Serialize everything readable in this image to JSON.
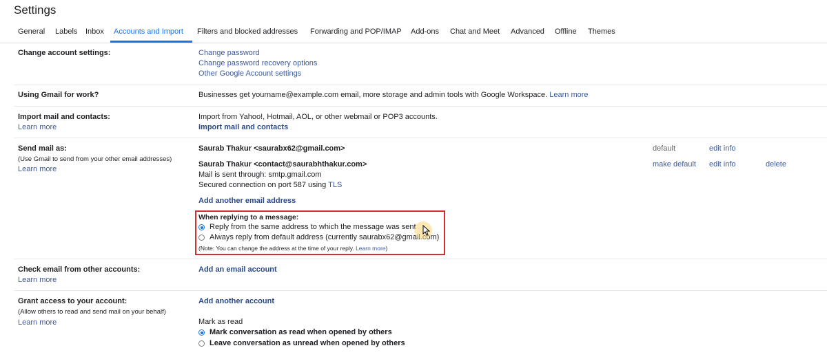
{
  "page_title": "Settings",
  "tabs": [
    {
      "label": "General"
    },
    {
      "label": "Labels"
    },
    {
      "label": "Inbox"
    },
    {
      "label": "Accounts and Import",
      "active": true
    },
    {
      "label": "Filters and blocked addresses"
    },
    {
      "label": "Forwarding and POP/IMAP"
    },
    {
      "label": "Add-ons"
    },
    {
      "label": "Chat and Meet"
    },
    {
      "label": "Advanced"
    },
    {
      "label": "Offline"
    },
    {
      "label": "Themes"
    }
  ],
  "change_account": {
    "label": "Change account settings:",
    "links": [
      "Change password",
      "Change password recovery options",
      "Other Google Account settings"
    ]
  },
  "gmail_work": {
    "label": "Using Gmail for work?",
    "text": "Businesses get yourname@example.com email, more storage and admin tools with Google Workspace.",
    "learn_more": "Learn more"
  },
  "import_mail": {
    "label": "Import mail and contacts:",
    "learn_more": "Learn more",
    "text": "Import from Yahoo!, Hotmail, AOL, or other webmail or POP3 accounts.",
    "action": "Import mail and contacts"
  },
  "send_mail": {
    "label": "Send mail as:",
    "sub": "(Use Gmail to send from your other email addresses)",
    "learn_more": "Learn more",
    "addresses": [
      {
        "name": "Saurab Thakur <saurabx62@gmail.com>",
        "status": "default",
        "edit": "edit info"
      },
      {
        "name": "Saurab Thakur <contact@saurabhthakur.com>",
        "line1": "Mail is sent through: smtp.gmail.com",
        "line2_prefix": "Secured connection on port 587 using",
        "line2_link": "TLS",
        "status": "make default",
        "edit": "edit info",
        "delete": "delete"
      }
    ],
    "add_address": "Add another email address",
    "reply": {
      "heading": "When replying to a message:",
      "option1": "Reply from the same address to which the message was sent",
      "option2": "Always reply from default address (currently saurabx62@gmail.com)",
      "note_prefix": "(Note: You can change the address at the time of your reply.",
      "note_link": "Learn more",
      "note_suffix": ")",
      "selected": "option1"
    }
  },
  "check_email": {
    "label": "Check email from other accounts:",
    "learn_more": "Learn more",
    "action": "Add an email account"
  },
  "grant_access": {
    "label": "Grant access to your account:",
    "sub": "(Allow others to read and send mail on your behalf)",
    "learn_more": "Learn more",
    "action": "Add another account",
    "mark_heading": "Mark as read",
    "mark_option1": "Mark conversation as read when opened by others",
    "mark_option2": "Leave conversation as unread when opened by others",
    "selected": "option1"
  },
  "colors": {
    "accent": "#1a73e8",
    "link": "#3c5a9c",
    "highlight": "#d32f2f"
  }
}
